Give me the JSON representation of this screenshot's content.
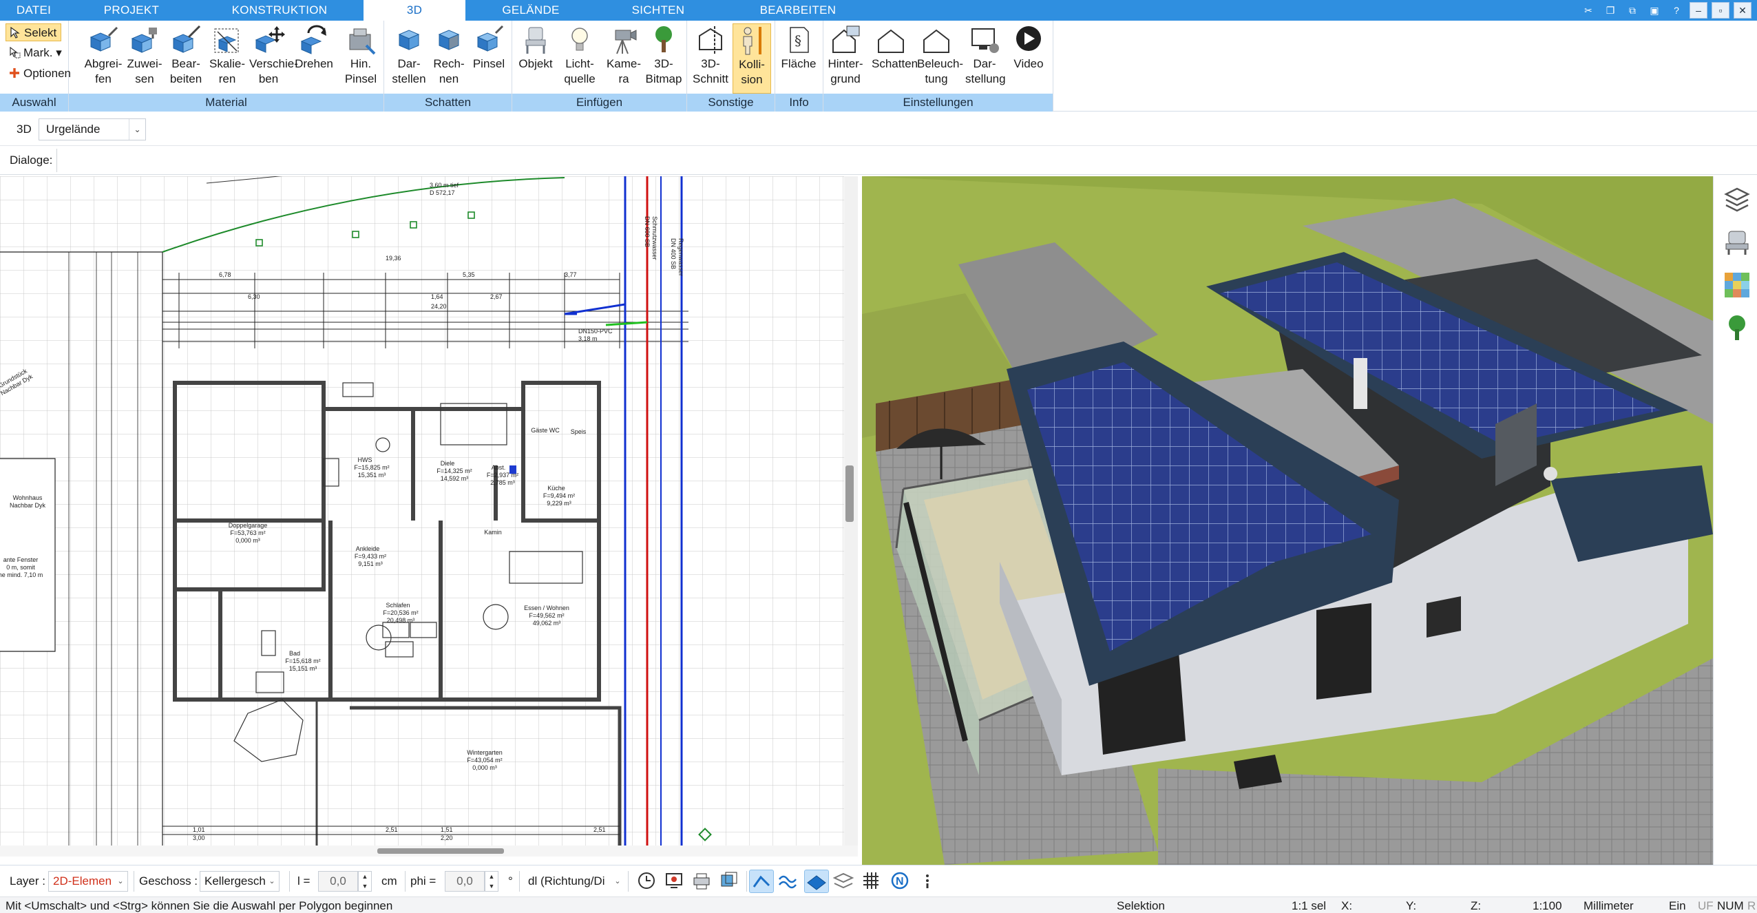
{
  "tabs": [
    {
      "label": "DATEI",
      "active": false
    },
    {
      "label": "PROJEKT",
      "active": false
    },
    {
      "label": "KONSTRUKTION",
      "active": false
    },
    {
      "label": "3D",
      "active": true
    },
    {
      "label": "GELÄNDE",
      "active": false
    },
    {
      "label": "SICHTEN",
      "active": false
    },
    {
      "label": "BEARBEITEN",
      "active": false
    }
  ],
  "ribbon": {
    "auswahl": {
      "title": "Auswahl",
      "selekt": "Selekt",
      "mark": "Mark.",
      "optionen": "Optionen"
    },
    "material": {
      "title": "Material",
      "buttons": [
        "Abgrei-\nfen",
        "Zuwei-\nsen",
        "Bear-\nbeiten",
        "Skalie-\nren",
        "Verschie-\nben",
        "Drehen",
        "Hin.\nPinsel"
      ]
    },
    "schatten": {
      "title": "Schatten",
      "buttons": [
        "Dar-\nstellen",
        "Rech-\nnen",
        "Pinsel"
      ]
    },
    "einfuegen": {
      "title": "Einfügen",
      "buttons": [
        "Objekt",
        "Licht-\nquelle",
        "Kame-\nra",
        "3D-\nBitmap"
      ]
    },
    "sonstige": {
      "title": "Sonstige",
      "buttons": [
        "3D-\nSchnitt",
        "Kolli-\nsion"
      ]
    },
    "info": {
      "title": "Info",
      "buttons": [
        "Fläche"
      ]
    },
    "einstellungen": {
      "title": "Einstellungen",
      "buttons": [
        "Hinter-\ngrund",
        "Schatten",
        "Beleuch-\ntung",
        "Dar-\nstellung",
        "Video"
      ]
    }
  },
  "toolbar3d": {
    "label": "3D",
    "terrain_value": "Urgelände"
  },
  "dialoge": {
    "label": "Dialoge:"
  },
  "plan": {
    "labels": {
      "garage": "Doppelgarage",
      "garage_area": "F=53,763 m²",
      "garage_vol": "0,000 m³",
      "hws": "HWS",
      "hws_area": "F=15,825 m²",
      "hws_vol": "15,351 m³",
      "diele": "Diele",
      "diele_area": "F=14,325 m²",
      "diele_vol": "14,592 m³",
      "abst": "Abst.",
      "abst_area": "F=2,937 m²",
      "abst_vol": "2,785 m³",
      "kueche": "Küche",
      "kueche_area": "F=9,494 m²",
      "kueche_vol": "9,229 m³",
      "ankleide": "Ankleide",
      "ankleide_area": "F=9,433 m²",
      "ankleide_vol": "9,151 m³",
      "schlafen": "Schlafen",
      "schlafen_area": "F=20,536 m²",
      "schlafen_vol": "20,498 m³",
      "bad": "Bad",
      "bad_area": "F=15,618 m²",
      "bad_vol": "15,151 m³",
      "essen": "Essen / Wohnen",
      "essen_area": "F=49,562 m²",
      "essen_vol": "49,062 m³",
      "wintergarten": "Wintergarten",
      "wintergarten_area": "F=43,054 m²",
      "wintergarten_vol": "0,000 m³",
      "wc": "Gäste WC",
      "speis": "Speis",
      "kamin": "Kamin",
      "nachbar1": "Wohnhaus\nNachbar Dyk",
      "fenster": "ante Fenster\n0 m, somit\nhe mind. 7,10 m",
      "grundstueck": "Grundstück\nNachbar Dyk",
      "schmutz": "Schmutzwasser\nDN 600 SB",
      "regen": "Regenwasser\nDN 400 SB",
      "dn150": "DN150-PVC\n3,18 m",
      "top": "3,60 m tief\nD 572,17",
      "dims_top": [
        "6,78",
        "5,35",
        "3,77",
        "19,36",
        "6,30",
        "1,64",
        "2,67",
        "24,20"
      ],
      "dims_bottom": [
        "1,01",
        "3,00",
        "2,51",
        "1,51",
        "2,20",
        "2,51"
      ]
    }
  },
  "dock": {
    "icons": [
      "layers-icon",
      "furniture-icon",
      "materials-icon",
      "tree-icon"
    ]
  },
  "inputbar": {
    "layer_label": "Layer :",
    "layer_value": "2D-Elemen",
    "geschoss_label": "Geschoss :",
    "geschoss_value": "Kellergesch",
    "l_label": "l =",
    "l_value": "0,0",
    "l_unit": "cm",
    "phi_label": "phi =",
    "phi_value": "0,0",
    "phi_unit": "°",
    "dl_value": "dl (Richtung/Di"
  },
  "status": {
    "hint": "Mit <Umschalt> und <Strg> können Sie die Auswahl per Polygon beginnen",
    "mode": "Selektion",
    "sel": "1:1 sel",
    "x": "X:",
    "y": "Y:",
    "z": "Z:",
    "scale": "1:100",
    "unit": "Millimeter",
    "ein": "Ein",
    "uf": "UF",
    "num": "NUM",
    "r": "R"
  },
  "colors": {
    "accent": "#2f8fe0",
    "group_footer": "#a9d3f7",
    "active_button": "#ffe49a"
  }
}
